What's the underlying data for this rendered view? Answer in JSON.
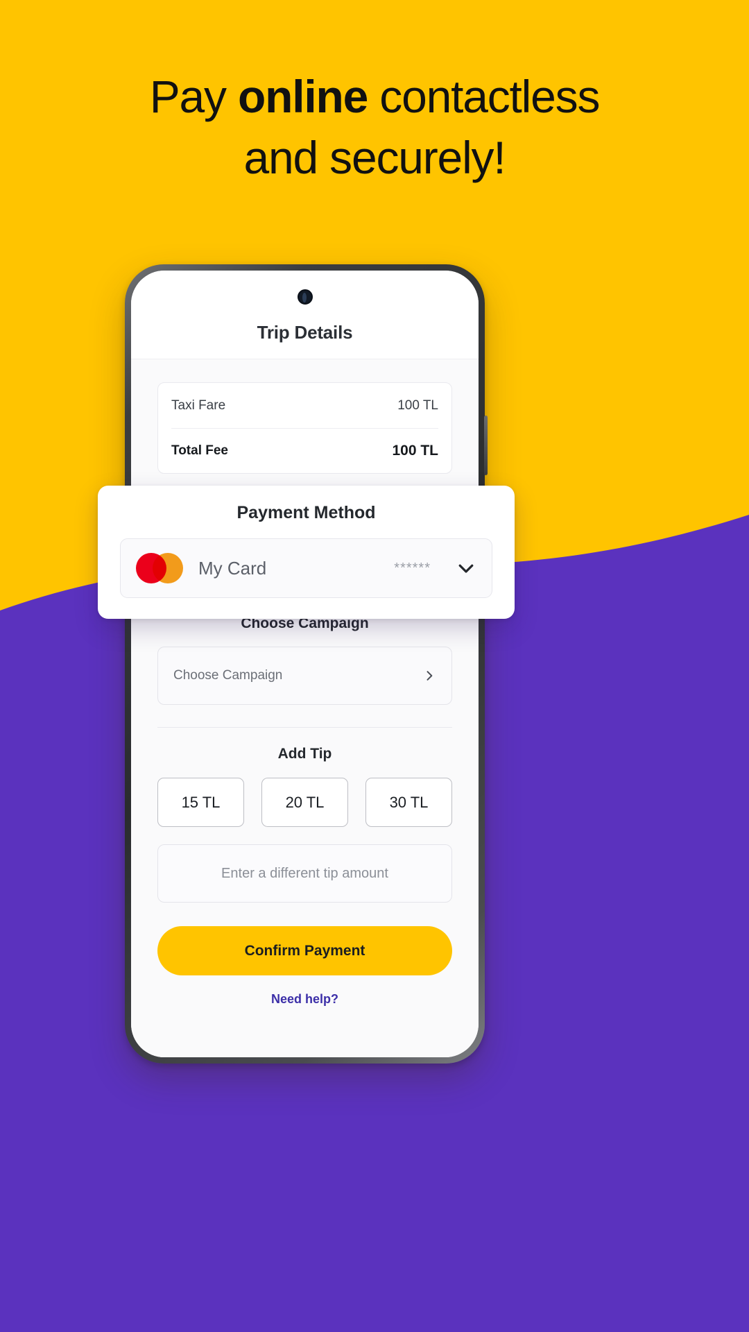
{
  "promo": {
    "headline_part1": "Pay ",
    "headline_bold": "online",
    "headline_part2": " contactless",
    "headline_line2": "and securely!"
  },
  "colors": {
    "brand_yellow": "#FFC400",
    "brand_purple": "#5B32BE",
    "mastercard_red": "#EB001B",
    "mastercard_orange": "#F79E1B",
    "link_purple": "#3C2FA8"
  },
  "app": {
    "header": {
      "title": "Trip Details"
    },
    "fare": {
      "rows": [
        {
          "label": "Taxi Fare",
          "value": "100 TL"
        },
        {
          "label": "Total Fee",
          "value": "100 TL"
        }
      ]
    },
    "payment_method": {
      "title": "Payment Method",
      "card_name": "My Card",
      "card_mask": "******",
      "brand_icon": "mastercard-icon",
      "chevron_icon": "chevron-down-icon"
    },
    "campaign": {
      "title": "Choose Campaign",
      "field_placeholder": "Choose Campaign",
      "chevron_icon": "chevron-right-icon"
    },
    "tip": {
      "title": "Add Tip",
      "options": [
        "15 TL",
        "20 TL",
        "30 TL"
      ],
      "custom_placeholder": "Enter a different tip amount"
    },
    "cta": {
      "confirm_label": "Confirm Payment",
      "help_label": "Need help?"
    }
  }
}
